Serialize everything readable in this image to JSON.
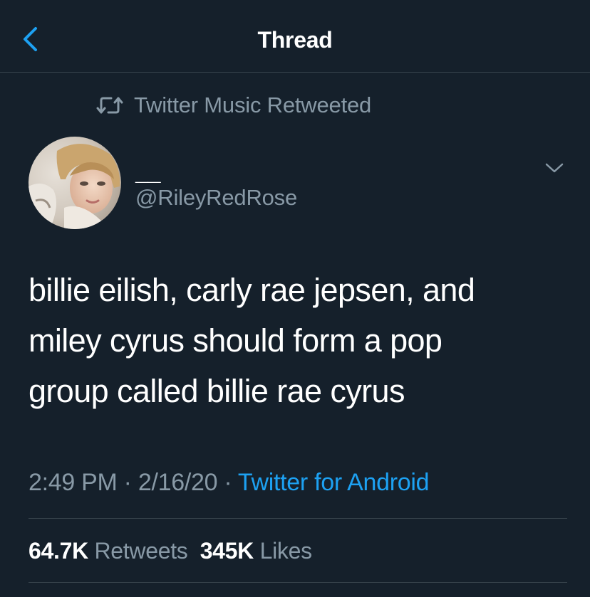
{
  "header": {
    "title": "Thread"
  },
  "social_context": {
    "text": "Twitter Music Retweeted",
    "icon": "retweet-icon"
  },
  "tweet": {
    "display_name": "__",
    "handle": "@RileyRedRose",
    "text": "billie eilish, carly rae jepsen, and\nmiley cyrus should form a pop\ngroup called billie rae cyrus",
    "time": "2:49 PM",
    "separator": " · ",
    "date": "2/16/20",
    "source": "Twitter for Android"
  },
  "stats": {
    "retweets_count": "64.7K",
    "retweets_label": "Retweets",
    "likes_count": "345K",
    "likes_label": "Likes"
  },
  "colors": {
    "background": "#15202b",
    "accent": "#1da1f2",
    "secondary_text": "#8899a6",
    "divider": "#38444d"
  }
}
